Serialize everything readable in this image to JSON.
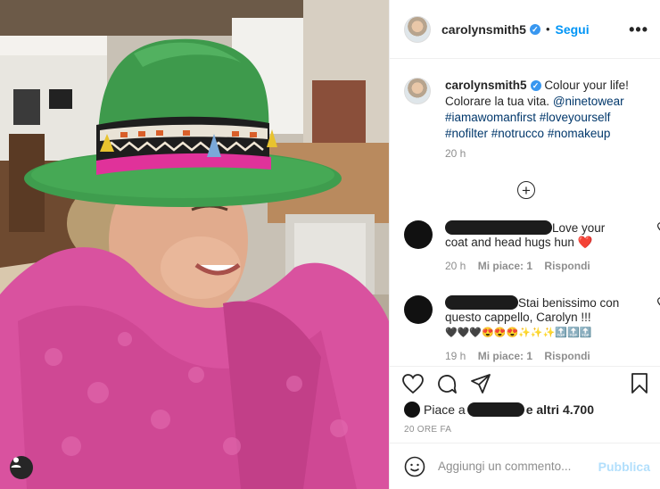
{
  "post": {
    "username": "carolynsmith5",
    "follow_label": "Segui",
    "more_label": "•••",
    "caption_lines": [
      "Colour your life!",
      "Colorare la tua vita.",
      "@ninetowear",
      "#iamawomanfirst #loveyourself",
      "#nofilter #notrucco #nomakeup"
    ],
    "caption_time": "20 h",
    "load_more_label": "+"
  },
  "comments": [
    {
      "text_lines": [
        "Love your",
        "coat and head hugs hun ❤️"
      ],
      "time": "20 h",
      "likes": "Mi piace: 1",
      "reply": "Rispondi"
    },
    {
      "text_lines": [
        "Stai benissimo con",
        "questo cappello, Carolyn !!!",
        "🖤🖤🖤😍😍😍✨✨✨🔝🔝🔝"
      ],
      "time": "19 h",
      "likes": "Mi piace: 1",
      "reply": "Rispondi"
    }
  ],
  "likes": {
    "prefix": "Piace a",
    "suffix": "e altri 4.700"
  },
  "date_label": "20 ORE FA",
  "add_comment": {
    "placeholder": "Aggiungi un commento...",
    "publish_label": "Pubblica"
  },
  "icons": [
    "heart-icon",
    "comment-icon",
    "share-icon",
    "bookmark-icon",
    "emoji-icon",
    "user-tag-icon",
    "plus-circle-icon"
  ],
  "colors": {
    "accent": "#0095f6",
    "verified": "#3897f0",
    "publish_disabled": "#b2dffc",
    "muted": "#8e8e8e"
  }
}
